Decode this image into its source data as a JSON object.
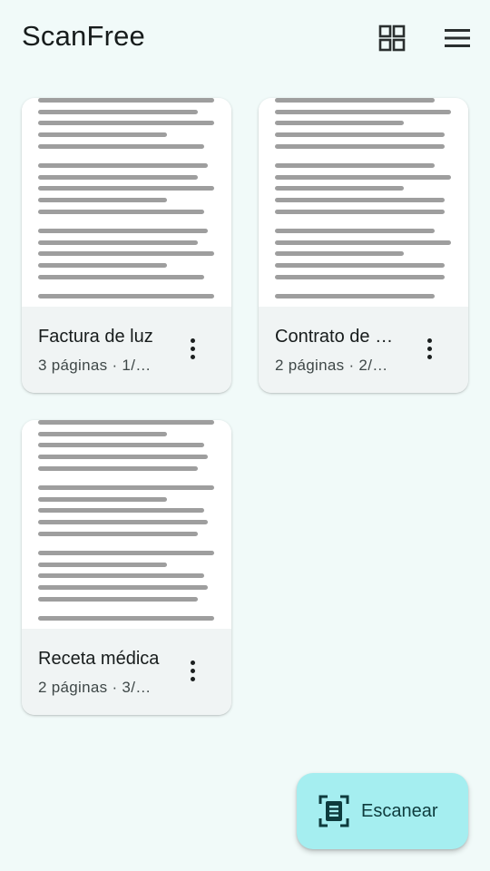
{
  "app_bar": {
    "title": "ScanFree",
    "grid_view_icon": "grid-view-icon",
    "menu_icon": "hamburger-menu-icon"
  },
  "documents": [
    {
      "name": "Factura de luz",
      "meta": "3 páginas · 1/…"
    },
    {
      "name": "Contrato de alquiler",
      "meta": "2 páginas · 2/…"
    },
    {
      "name": "Receta médica",
      "meta": "2 páginas · 3/…"
    }
  ],
  "fab": {
    "label": "Escanear",
    "icon": "document-scan-icon"
  },
  "colors": {
    "background": "#f1faf9",
    "card": "#f0f4f4",
    "fab": "#a5eef0",
    "fab_text": "#0e3b3d"
  }
}
